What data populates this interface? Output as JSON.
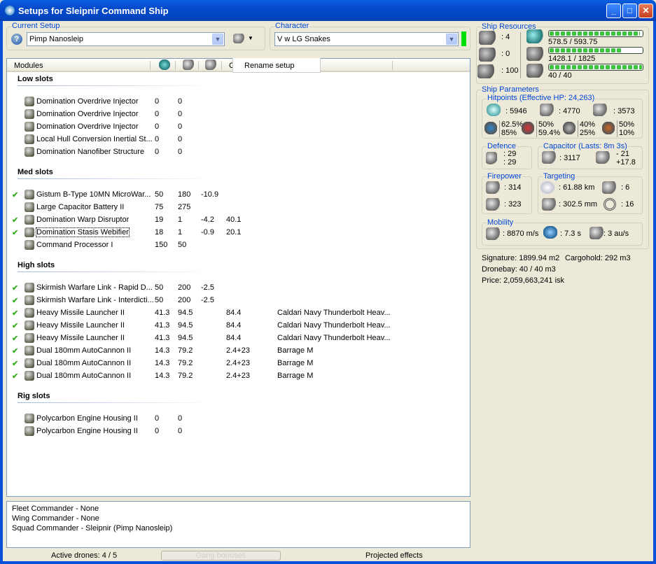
{
  "window": {
    "title": "Setups for Sleipnir Command Ship",
    "minimize": "_",
    "maximize": "□",
    "close": "✕"
  },
  "setup": {
    "label": "Current Setup",
    "value": "Pimp Nanosleip",
    "help_icon": "?"
  },
  "character": {
    "label": "Character",
    "value": "V w LG Snakes",
    "status_color": "#00e000"
  },
  "menu": {
    "rename": "Rename setup"
  },
  "modules": {
    "header": "Modules",
    "header_partial": "C",
    "sections": [
      {
        "title": "Low slots",
        "rows": [
          {
            "checked": false,
            "name": "Domination Overdrive Injector",
            "c": [
              "0",
              "0",
              "",
              "",
              ""
            ]
          },
          {
            "checked": false,
            "name": "Domination Overdrive Injector",
            "c": [
              "0",
              "0",
              "",
              "",
              ""
            ]
          },
          {
            "checked": false,
            "name": "Domination Overdrive Injector",
            "c": [
              "0",
              "0",
              "",
              "",
              ""
            ]
          },
          {
            "checked": false,
            "name": "Local Hull Conversion Inertial St...",
            "c": [
              "0",
              "0",
              "",
              "",
              ""
            ]
          },
          {
            "checked": false,
            "name": "Domination Nanofiber Structure",
            "c": [
              "0",
              "0",
              "",
              "",
              ""
            ]
          }
        ]
      },
      {
        "title": "Med slots",
        "rows": [
          {
            "checked": true,
            "name": "Gistum B-Type 10MN MicroWar...",
            "c": [
              "50",
              "180",
              "-10.9",
              "",
              ""
            ]
          },
          {
            "checked": false,
            "name": "Large Capacitor Battery II",
            "c": [
              "75",
              "275",
              "",
              "",
              ""
            ]
          },
          {
            "checked": true,
            "name": "Domination Warp Disruptor",
            "c": [
              "19",
              "1",
              "-4.2",
              "40.1",
              ""
            ]
          },
          {
            "checked": true,
            "name": "Domination Stasis Webifier",
            "c": [
              "18",
              "1",
              "-0.9",
              "20.1",
              ""
            ],
            "focused": true
          },
          {
            "checked": false,
            "name": "Command Processor I",
            "c": [
              "150",
              "50",
              "",
              "",
              ""
            ]
          }
        ]
      },
      {
        "title": "High slots",
        "rows": [
          {
            "checked": true,
            "name": "Skirmish Warfare Link - Rapid D...",
            "c": [
              "50",
              "200",
              "-2.5",
              "",
              ""
            ]
          },
          {
            "checked": true,
            "name": "Skirmish Warfare Link - Interdicti...",
            "c": [
              "50",
              "200",
              "-2.5",
              "",
              ""
            ]
          },
          {
            "checked": true,
            "name": "Heavy Missile Launcher II",
            "c": [
              "41.3",
              "94.5",
              "",
              "84.4",
              "Caldari Navy Thunderbolt Heav..."
            ]
          },
          {
            "checked": true,
            "name": "Heavy Missile Launcher II",
            "c": [
              "41.3",
              "94.5",
              "",
              "84.4",
              "Caldari Navy Thunderbolt Heav..."
            ]
          },
          {
            "checked": true,
            "name": "Heavy Missile Launcher II",
            "c": [
              "41.3",
              "94.5",
              "",
              "84.4",
              "Caldari Navy Thunderbolt Heav..."
            ]
          },
          {
            "checked": true,
            "name": "Dual 180mm AutoCannon II",
            "c": [
              "14.3",
              "79.2",
              "",
              "2.4+23",
              "Barrage M"
            ]
          },
          {
            "checked": true,
            "name": "Dual 180mm AutoCannon II",
            "c": [
              "14.3",
              "79.2",
              "",
              "2.4+23",
              "Barrage M"
            ]
          },
          {
            "checked": true,
            "name": "Dual 180mm AutoCannon II",
            "c": [
              "14.3",
              "79.2",
              "",
              "2.4+23",
              "Barrage M"
            ]
          }
        ]
      },
      {
        "title": "Rig slots",
        "rows": [
          {
            "checked": false,
            "name": "Polycarbon Engine Housing II",
            "c": [
              "0",
              "0",
              "",
              "",
              ""
            ]
          },
          {
            "checked": false,
            "name": "Polycarbon Engine Housing II",
            "c": [
              "0",
              "0",
              "",
              "",
              ""
            ]
          }
        ]
      }
    ]
  },
  "fleet": [
    "Fleet Commander - None",
    "Wing Commander - None",
    "Squad Commander - Sleipnir (Pimp Nanosleip)"
  ],
  "status": {
    "drones": "Active drones: 4 / 5",
    "gang": "Gang bonuses",
    "projected": "Projected effects"
  },
  "resources": {
    "label": "Ship Resources",
    "turrets": ": 4",
    "launchers": ": 0",
    "calibration": ": 100",
    "cpu": {
      "text": "578.5 / 593.75",
      "fraction": 0.974
    },
    "powergrid": {
      "text": "1428.1 / 1825",
      "fraction": 0.782
    },
    "drones": {
      "text": "40 / 40",
      "fraction": 1.0
    }
  },
  "params": {
    "label": "Ship Parameters",
    "hp": {
      "label": "Hitpoints (Effective HP: 24,263)",
      "shield": ": 5946",
      "armor": ": 4770",
      "structure": ": 3573",
      "resists": [
        [
          "62.5%",
          "85%"
        ],
        [
          "50%",
          "59.4%"
        ],
        [
          "40%",
          "25%"
        ],
        [
          "50%",
          "10%"
        ]
      ]
    },
    "defence": {
      "label": "Defence",
      "a": ": 29",
      "b": ": 29"
    },
    "capacitor": {
      "label": "Capacitor (Lasts: 8m 3s)",
      "capacity": ": 3117",
      "use": "- 21",
      "recharge": "+17.8"
    },
    "firepower": {
      "label": "Firepower",
      "turret": ": 314",
      "missile": ": 323"
    },
    "targeting": {
      "label": "Targeting",
      "range": ": 61.88 km",
      "targets": ": 6",
      "scan": ": 302.5 mm",
      "sensor": ": 16"
    },
    "mobility": {
      "label": "Mobility",
      "speed": ": 8870 m/s",
      "align": ": 7.3 s",
      "warp": ": 3 au/s"
    },
    "signature": "Signature: 1899.94 m2",
    "cargo": "Cargohold: 292 m3",
    "dronebay": "Dronebay: 40 / 40 m3",
    "price": "Price: 2,059,663,241 isk"
  }
}
